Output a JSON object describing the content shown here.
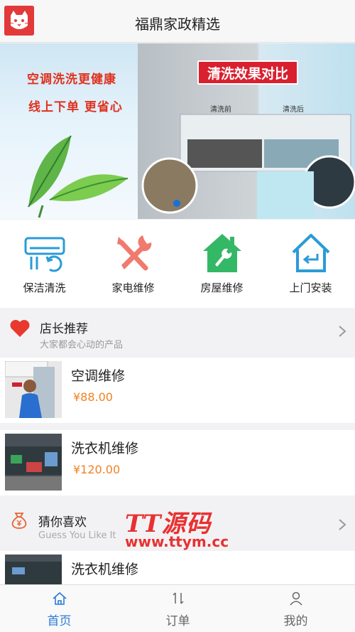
{
  "header": {
    "title": "福鼎家政精选",
    "logo_icon": "cat-logo-icon"
  },
  "banner": {
    "slogan_line1": "空调洗洗更健康",
    "slogan_line2": "线上下单 更省心",
    "badge": "清洗效果对比",
    "before_label": "清洗前",
    "after_label": "清洗后"
  },
  "categories": [
    {
      "label": "保洁清洗",
      "icon": "ac-clean-icon",
      "color": "#2a9bd8"
    },
    {
      "label": "家电维修",
      "icon": "tools-icon",
      "color": "#f07a6e"
    },
    {
      "label": "房屋维修",
      "icon": "house-wrench-icon",
      "color": "#35b866"
    },
    {
      "label": "上门安装",
      "icon": "home-return-icon",
      "color": "#2a9bd8"
    }
  ],
  "recommend": {
    "title": "店长推荐",
    "subtitle": "大家都会心动的产品",
    "icon": "heart-icon"
  },
  "products": [
    {
      "name": "空调维修",
      "price": "¥88.00"
    },
    {
      "name": "洗衣机维修",
      "price": "¥120.00"
    }
  ],
  "guess": {
    "title": "猜你喜欢",
    "subtitle": "Guess You Like It",
    "icon": "money-bag-icon",
    "first_item": "洗衣机维修"
  },
  "watermark": {
    "line1": "TT源码",
    "line2": "www.ttym.cc"
  },
  "tabs": [
    {
      "label": "首页",
      "icon": "home-icon",
      "active": true
    },
    {
      "label": "订单",
      "icon": "sort-arrows-icon",
      "active": false
    },
    {
      "label": "我的",
      "icon": "user-icon",
      "active": false
    }
  ],
  "colors": {
    "accent": "#2d7ad6",
    "price": "#f08321",
    "heart": "#e8392f"
  }
}
